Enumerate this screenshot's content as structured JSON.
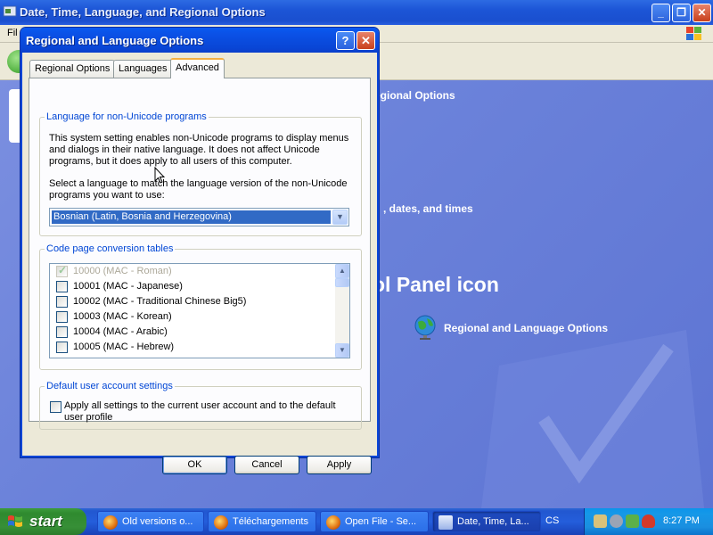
{
  "background_window": {
    "title": "Date, Time, Language, and Regional Options",
    "menu_file": "Fil",
    "header_text": "egional Options",
    "subtext": ", dates, and times",
    "big_text": "ol Panel icon",
    "link_label": "Regional and Language Options"
  },
  "dialog": {
    "title": "Regional and Language Options",
    "help_label": "?",
    "close_label": "✕",
    "tabs": [
      {
        "label": "Regional Options"
      },
      {
        "label": "Languages"
      },
      {
        "label": "Advanced"
      }
    ],
    "non_unicode": {
      "legend": "Language for non-Unicode programs",
      "desc_lines": [
        "This system setting enables non-Unicode programs to display menus",
        "and dialogs in their native language. It does not affect Unicode",
        "programs, but it does apply to all users of this computer."
      ],
      "select_lines": [
        "Select a language to match the language version of the non-Unicode",
        "programs you want to use:"
      ],
      "selected_language": "Bosnian (Latin, Bosnia and Herzegovina)"
    },
    "code_page": {
      "legend": "Code page conversion tables",
      "rows": [
        {
          "label": "10000 (MAC - Roman)",
          "checked": true,
          "disabled": true
        },
        {
          "label": "10001 (MAC - Japanese)",
          "checked": false,
          "disabled": false
        },
        {
          "label": "10002 (MAC - Traditional Chinese Big5)",
          "checked": false,
          "disabled": false
        },
        {
          "label": "10003 (MAC - Korean)",
          "checked": false,
          "disabled": false
        },
        {
          "label": "10004 (MAC - Arabic)",
          "checked": false,
          "disabled": false
        },
        {
          "label": "10005 (MAC - Hebrew)",
          "checked": false,
          "disabled": false
        }
      ]
    },
    "default_user": {
      "legend": "Default user account settings",
      "checkbox_lines": [
        "Apply all settings to the current user account and to the default",
        "user profile"
      ],
      "checked": false
    },
    "buttons": {
      "ok": "OK",
      "cancel": "Cancel",
      "apply": "Apply"
    }
  },
  "taskbar": {
    "start_label": "start",
    "tasks": [
      {
        "label": "Old versions o..."
      },
      {
        "label": "Téléchargements"
      },
      {
        "label": "Open File - Se..."
      },
      {
        "label": "Date, Time, La..."
      }
    ],
    "language_indicator": "CS",
    "clock": "8:27 PM"
  },
  "colors": {
    "accent_blue": "#0046d5",
    "selection": "#316ac5",
    "titlebar": "#0a50e5",
    "start_green": "#378f37"
  }
}
